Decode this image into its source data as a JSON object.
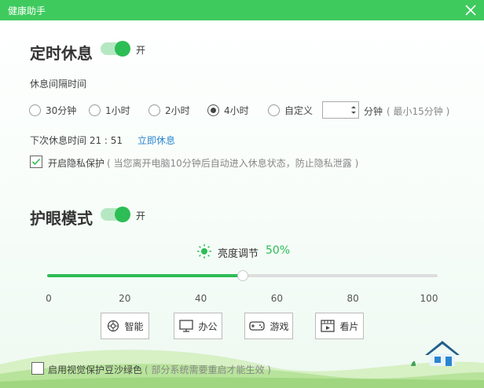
{
  "window": {
    "title": "健康助手"
  },
  "rest": {
    "title": "定时休息",
    "toggle_state": "开",
    "interval_label": "休息间隔时间",
    "options": [
      {
        "label": "30分钟",
        "checked": false
      },
      {
        "label": "1小时",
        "checked": false
      },
      {
        "label": "2小时",
        "checked": false
      },
      {
        "label": "4小时",
        "checked": true
      },
      {
        "label": "自定义",
        "checked": false
      }
    ],
    "custom_value": "",
    "minutes_label": "分钟",
    "minutes_hint": "( 最小15分钟 )",
    "next_rest_label": "下次休息时间 21 : 51",
    "rest_now_link": "立即休息",
    "privacy_label": "开启隐私保护",
    "privacy_hint": "( 当您离开电脑10分钟后自动进入休息状态，防止隐私泄露 )",
    "privacy_checked": true
  },
  "eye": {
    "title": "护眼模式",
    "toggle_state": "开",
    "brightness_label": "亮度调节",
    "brightness_value": "50%",
    "brightness_level": 50,
    "ticks": [
      "0",
      "20",
      "40",
      "60",
      "80",
      "100"
    ],
    "modes": [
      {
        "label": "智能",
        "icon": "brain-icon"
      },
      {
        "label": "办公",
        "icon": "monitor-icon"
      },
      {
        "label": "游戏",
        "icon": "gamepad-icon"
      },
      {
        "label": "看片",
        "icon": "film-icon"
      }
    ]
  },
  "footer": {
    "green_label": "启用视觉保护豆沙绿色",
    "green_hint": "( 部分系统需要重启才能生效 )",
    "green_checked": false
  },
  "colors": {
    "accent": "#2dbd55",
    "titlebar": "#3fca5e",
    "link": "#2a85d0"
  }
}
